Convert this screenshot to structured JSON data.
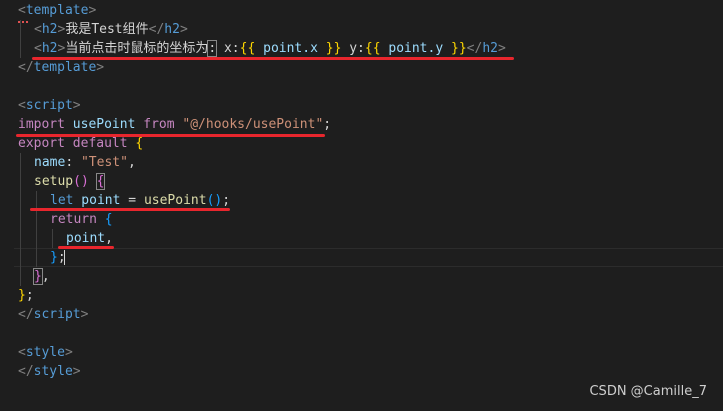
{
  "code": {
    "l1": {
      "open": "<",
      "tag": "template",
      "close": ">"
    },
    "l2": {
      "open": "<",
      "tag": "h2",
      "close": ">",
      "text": "我是Test组件",
      "eopen": "</",
      "etag": "h2",
      "eclose": ">"
    },
    "l3": {
      "open": "<",
      "tag": "h2",
      "close": ">",
      "text": "当前点击时鼠标的坐标为",
      "colon": ":",
      "xlabel": " x:",
      "mustache_open1": "{{",
      "expr1": " point.x ",
      "mustache_close1": "}}",
      "ylabel": " y:",
      "mustache_open2": "{{",
      "expr2": " point.y ",
      "mustache_close2": "}}",
      "eopen": "</",
      "etag": "h2",
      "eclose": ">"
    },
    "l4": {
      "open": "</",
      "tag": "template",
      "close": ">"
    },
    "l6": {
      "open": "<",
      "tag": "script",
      "close": ">"
    },
    "l7": {
      "kw1": "import",
      "name": " usePoint ",
      "kw2": "from",
      "sp": " ",
      "str": "\"@/hooks/usePoint\"",
      "end": ";"
    },
    "l8": {
      "kw": "export",
      "kw2": " default",
      "sp": " ",
      "brace": "{"
    },
    "l9": {
      "prop": "name",
      "colon": ": ",
      "str": "\"Test\"",
      "comma": ","
    },
    "l10": {
      "fn": "setup",
      "paren": "()",
      "sp": " ",
      "brace": "{"
    },
    "l11": {
      "kw": "let",
      "name": " point",
      "eq": " = ",
      "fn": "usePoint",
      "paren": "()",
      "end": ";"
    },
    "l12": {
      "kw": "return",
      "sp": " ",
      "brace": "{"
    },
    "l13": {
      "name": "point",
      "comma": ","
    },
    "l14": {
      "brace": "}",
      "end": ";"
    },
    "l15": {
      "brace": "}",
      "comma": ","
    },
    "l16": {
      "brace": "}",
      "end": ";"
    },
    "l17": {
      "open": "</",
      "tag": "script",
      "close": ">"
    },
    "l19": {
      "open": "<",
      "tag": "style",
      "close": ">"
    },
    "l20": {
      "open": "</",
      "tag": "style",
      "close": ">"
    }
  },
  "watermark": "CSDN @Camille_7",
  "colors": {
    "background": "#1e1e1e",
    "annotation_underline": "#e8262d",
    "tag": "#569cd6",
    "keyword": "#c586c0",
    "string": "#ce9178",
    "function": "#dcdcaa",
    "property": "#9cdcfe"
  }
}
